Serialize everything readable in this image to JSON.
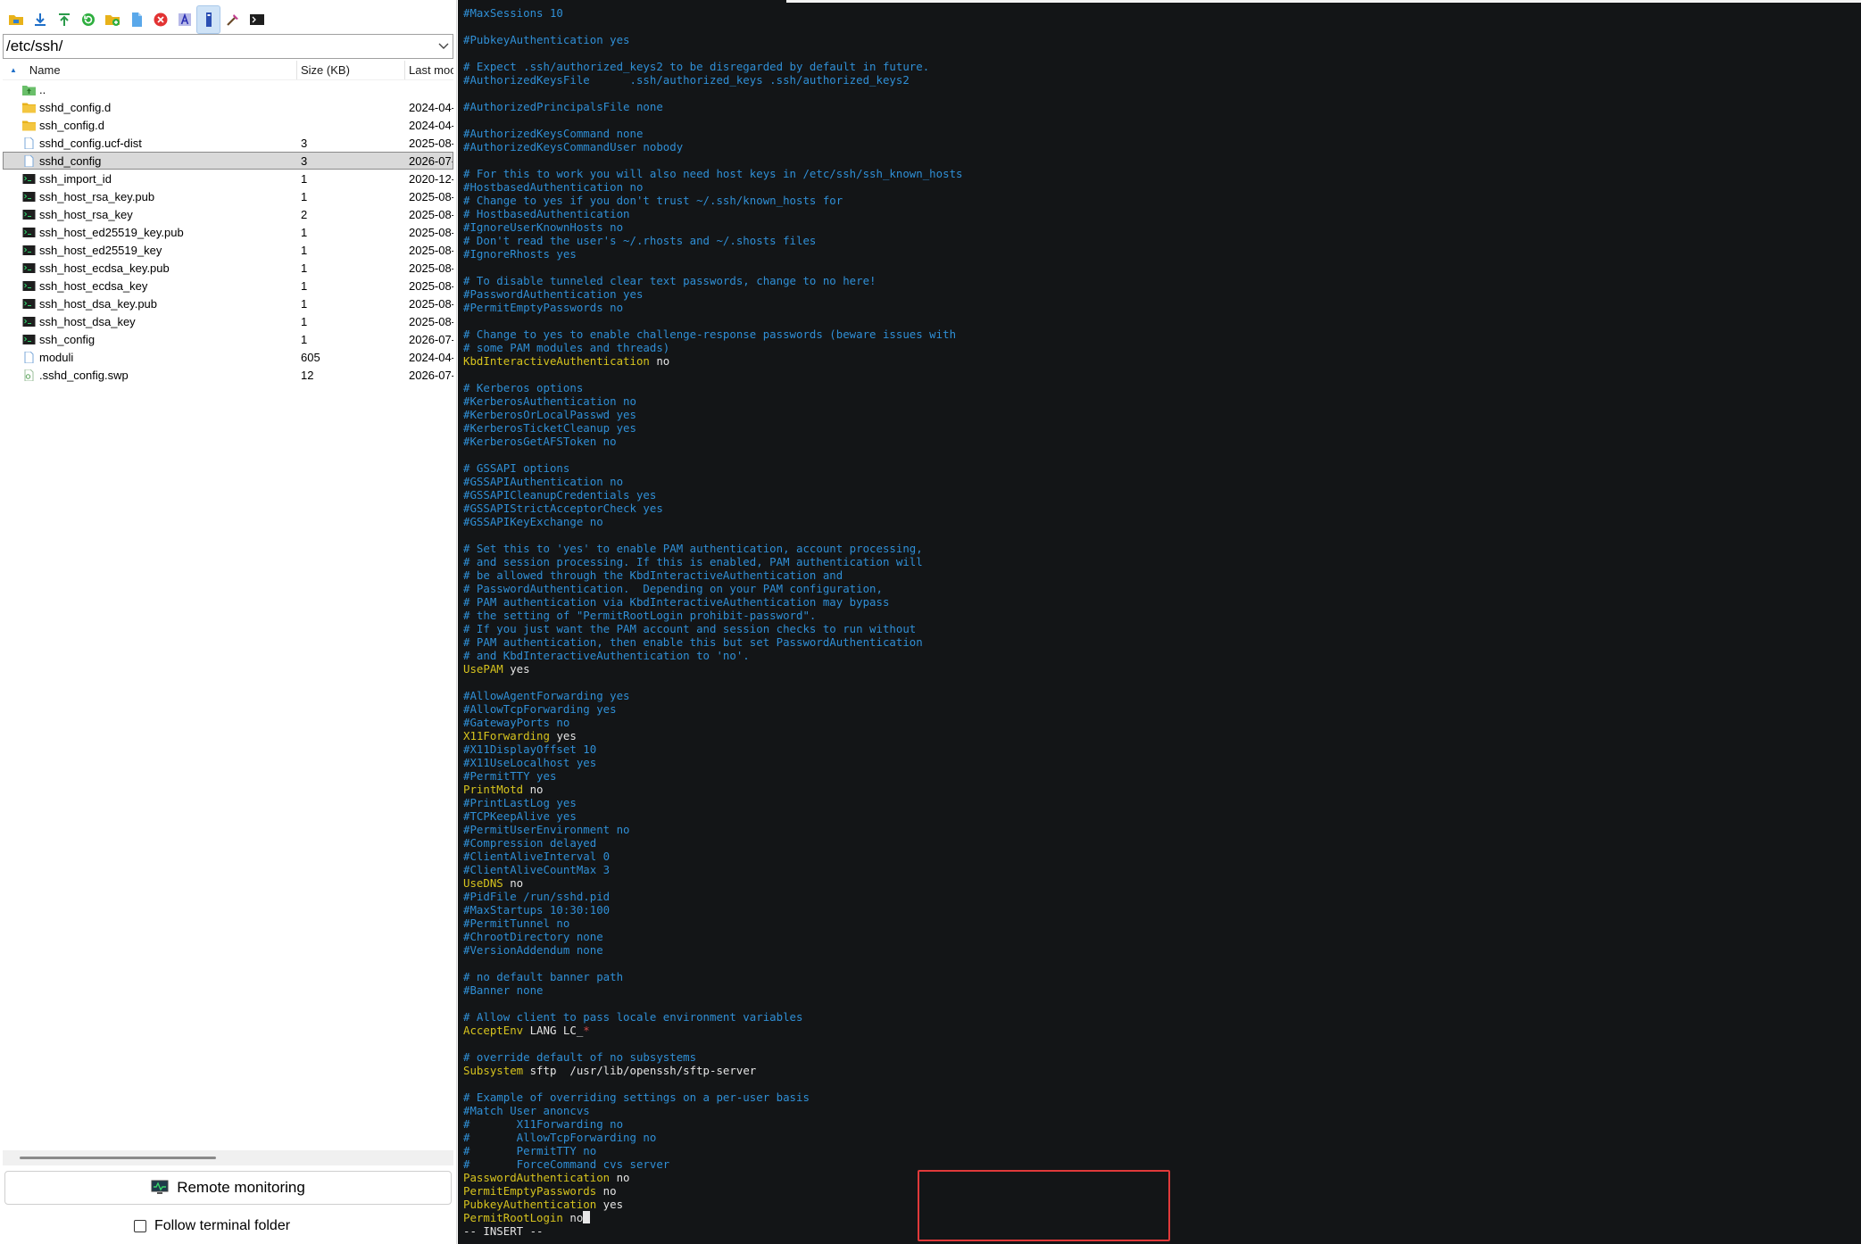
{
  "toolbar": {
    "icons": [
      "open-folder-icon",
      "download-icon",
      "upload-icon",
      "refresh-icon",
      "new-folder-icon",
      "new-file-icon",
      "delete-icon",
      "rename-icon",
      "show-hidden-icon",
      "tools-icon",
      "terminal-icon"
    ],
    "active_icon": "show-hidden-icon"
  },
  "path": {
    "value": "/etc/ssh/"
  },
  "columns": {
    "name": "Name",
    "size": "Size (KB)",
    "date": "Last moc"
  },
  "files": [
    {
      "name": "..",
      "size": "",
      "date": "",
      "icon": "up-folder-icon",
      "selected": false
    },
    {
      "name": "sshd_config.d",
      "size": "",
      "date": "2024-04-",
      "icon": "folder-icon",
      "selected": false
    },
    {
      "name": "ssh_config.d",
      "size": "",
      "date": "2024-04-",
      "icon": "folder-icon",
      "selected": false
    },
    {
      "name": "sshd_config.ucf-dist",
      "size": "3",
      "date": "2025-08-",
      "icon": "text-file-icon",
      "selected": false
    },
    {
      "name": "sshd_config",
      "size": "3",
      "date": "2026-07-",
      "icon": "text-file-icon",
      "selected": true
    },
    {
      "name": "ssh_import_id",
      "size": "1",
      "date": "2020-12-",
      "icon": "console-file-icon",
      "selected": false
    },
    {
      "name": "ssh_host_rsa_key.pub",
      "size": "1",
      "date": "2025-08-",
      "icon": "console-file-icon",
      "selected": false
    },
    {
      "name": "ssh_host_rsa_key",
      "size": "2",
      "date": "2025-08-",
      "icon": "console-file-icon",
      "selected": false
    },
    {
      "name": "ssh_host_ed25519_key.pub",
      "size": "1",
      "date": "2025-08-",
      "icon": "console-file-icon",
      "selected": false
    },
    {
      "name": "ssh_host_ed25519_key",
      "size": "1",
      "date": "2025-08-",
      "icon": "console-file-icon",
      "selected": false
    },
    {
      "name": "ssh_host_ecdsa_key.pub",
      "size": "1",
      "date": "2025-08-",
      "icon": "console-file-icon",
      "selected": false
    },
    {
      "name": "ssh_host_ecdsa_key",
      "size": "1",
      "date": "2025-08-",
      "icon": "console-file-icon",
      "selected": false
    },
    {
      "name": "ssh_host_dsa_key.pub",
      "size": "1",
      "date": "2025-08-",
      "icon": "console-file-icon",
      "selected": false
    },
    {
      "name": "ssh_host_dsa_key",
      "size": "1",
      "date": "2025-08-",
      "icon": "console-file-icon",
      "selected": false
    },
    {
      "name": "ssh_config",
      "size": "1",
      "date": "2026-07-",
      "icon": "console-file-icon",
      "selected": false
    },
    {
      "name": "moduli",
      "size": "605",
      "date": "2024-04-",
      "icon": "text-file-icon",
      "selected": false
    },
    {
      "name": ".sshd_config.swp",
      "size": "12",
      "date": "2026-07-",
      "icon": "swap-file-icon",
      "selected": false
    }
  ],
  "remote_monitoring": {
    "label": "Remote monitoring"
  },
  "follow_terminal": {
    "label": "Follow terminal folder",
    "checked": false
  },
  "colors": {
    "comment": "#2f8fd6",
    "keyword": "#d6c31e",
    "value": "#e4e4e4",
    "highlight_border": "#e0393a",
    "terminal_bg": "#131517"
  },
  "terminal": {
    "lines": [
      [
        {
          "t": "#MaxSessions 10",
          "s": "c"
        }
      ],
      [],
      [
        {
          "t": "#PubkeyAuthentication yes",
          "s": "c"
        }
      ],
      [],
      [
        {
          "t": "# Expect .ssh/authorized_keys2 to be disregarded by default in future.",
          "s": "c"
        }
      ],
      [
        {
          "t": "#AuthorizedKeysFile      .ssh/authorized_keys .ssh/authorized_keys2",
          "s": "c"
        }
      ],
      [],
      [
        {
          "t": "#AuthorizedPrincipalsFile none",
          "s": "c"
        }
      ],
      [],
      [
        {
          "t": "#AuthorizedKeysCommand none",
          "s": "c"
        }
      ],
      [
        {
          "t": "#AuthorizedKeysCommandUser nobody",
          "s": "c"
        }
      ],
      [],
      [
        {
          "t": "# For this to work you will also need host keys in /etc/ssh/ssh_known_hosts",
          "s": "c"
        }
      ],
      [
        {
          "t": "#HostbasedAuthentication no",
          "s": "c"
        }
      ],
      [
        {
          "t": "# Change to yes if you don't trust ~/.ssh/known_hosts for",
          "s": "c"
        }
      ],
      [
        {
          "t": "# HostbasedAuthentication",
          "s": "c"
        }
      ],
      [
        {
          "t": "#IgnoreUserKnownHosts no",
          "s": "c"
        }
      ],
      [
        {
          "t": "# Don't read the user's ~/.rhosts and ~/.shosts files",
          "s": "c"
        }
      ],
      [
        {
          "t": "#IgnoreRhosts yes",
          "s": "c"
        }
      ],
      [],
      [
        {
          "t": "# To disable tunneled clear text passwords, change to no here!",
          "s": "c"
        }
      ],
      [
        {
          "t": "#PasswordAuthentication yes",
          "s": "c"
        }
      ],
      [
        {
          "t": "#PermitEmptyPasswords no",
          "s": "c"
        }
      ],
      [],
      [
        {
          "t": "# Change to yes to enable challenge-response passwords (beware issues with",
          "s": "c"
        }
      ],
      [
        {
          "t": "# some PAM modules and threads)",
          "s": "c"
        }
      ],
      [
        {
          "t": "KbdInteractiveAuthentication",
          "s": "k"
        },
        {
          "t": " no",
          "s": "v"
        }
      ],
      [],
      [
        {
          "t": "# Kerberos options",
          "s": "c"
        }
      ],
      [
        {
          "t": "#KerberosAuthentication no",
          "s": "c"
        }
      ],
      [
        {
          "t": "#KerberosOrLocalPasswd yes",
          "s": "c"
        }
      ],
      [
        {
          "t": "#KerberosTicketCleanup yes",
          "s": "c"
        }
      ],
      [
        {
          "t": "#KerberosGetAFSToken no",
          "s": "c"
        }
      ],
      [],
      [
        {
          "t": "# GSSAPI options",
          "s": "c"
        }
      ],
      [
        {
          "t": "#GSSAPIAuthentication no",
          "s": "c"
        }
      ],
      [
        {
          "t": "#GSSAPICleanupCredentials yes",
          "s": "c"
        }
      ],
      [
        {
          "t": "#GSSAPIStrictAcceptorCheck yes",
          "s": "c"
        }
      ],
      [
        {
          "t": "#GSSAPIKeyExchange no",
          "s": "c"
        }
      ],
      [],
      [
        {
          "t": "# Set this to 'yes' to enable PAM authentication, account processing,",
          "s": "c"
        }
      ],
      [
        {
          "t": "# and session processing. If this is enabled, PAM authentication will",
          "s": "c"
        }
      ],
      [
        {
          "t": "# be allowed through the KbdInteractiveAuthentication and",
          "s": "c"
        }
      ],
      [
        {
          "t": "# PasswordAuthentication.  Depending on your PAM configuration,",
          "s": "c"
        }
      ],
      [
        {
          "t": "# PAM authentication via KbdInteractiveAuthentication may bypass",
          "s": "c"
        }
      ],
      [
        {
          "t": "# the setting of \"PermitRootLogin prohibit-password\".",
          "s": "c"
        }
      ],
      [
        {
          "t": "# If you just want the PAM account and session checks to run without",
          "s": "c"
        }
      ],
      [
        {
          "t": "# PAM authentication, then enable this but set PasswordAuthentication",
          "s": "c"
        }
      ],
      [
        {
          "t": "# and KbdInteractiveAuthentication to 'no'.",
          "s": "c"
        }
      ],
      [
        {
          "t": "UsePAM",
          "s": "k"
        },
        {
          "t": " yes",
          "s": "v"
        }
      ],
      [],
      [
        {
          "t": "#AllowAgentForwarding yes",
          "s": "c"
        }
      ],
      [
        {
          "t": "#AllowTcpForwarding yes",
          "s": "c"
        }
      ],
      [
        {
          "t": "#GatewayPorts no",
          "s": "c"
        }
      ],
      [
        {
          "t": "X11Forwarding",
          "s": "k"
        },
        {
          "t": " yes",
          "s": "v"
        }
      ],
      [
        {
          "t": "#X11DisplayOffset 10",
          "s": "c"
        }
      ],
      [
        {
          "t": "#X11UseLocalhost yes",
          "s": "c"
        }
      ],
      [
        {
          "t": "#PermitTTY yes",
          "s": "c"
        }
      ],
      [
        {
          "t": "PrintMotd",
          "s": "k"
        },
        {
          "t": " no",
          "s": "v"
        }
      ],
      [
        {
          "t": "#PrintLastLog yes",
          "s": "c"
        }
      ],
      [
        {
          "t": "#TCPKeepAlive yes",
          "s": "c"
        }
      ],
      [
        {
          "t": "#PermitUserEnvironment no",
          "s": "c"
        }
      ],
      [
        {
          "t": "#Compression delayed",
          "s": "c"
        }
      ],
      [
        {
          "t": "#ClientAliveInterval 0",
          "s": "c"
        }
      ],
      [
        {
          "t": "#ClientAliveCountMax 3",
          "s": "c"
        }
      ],
      [
        {
          "t": "UseDNS",
          "s": "k"
        },
        {
          "t": " no",
          "s": "v"
        }
      ],
      [
        {
          "t": "#PidFile /run/sshd.pid",
          "s": "c"
        }
      ],
      [
        {
          "t": "#MaxStartups 10:30:100",
          "s": "c"
        }
      ],
      [
        {
          "t": "#PermitTunnel no",
          "s": "c"
        }
      ],
      [
        {
          "t": "#ChrootDirectory none",
          "s": "c"
        }
      ],
      [
        {
          "t": "#VersionAddendum none",
          "s": "c"
        }
      ],
      [],
      [
        {
          "t": "# no default banner path",
          "s": "c"
        }
      ],
      [
        {
          "t": "#Banner none",
          "s": "c"
        }
      ],
      [],
      [
        {
          "t": "# Allow client to pass locale environment variables",
          "s": "c"
        }
      ],
      [
        {
          "t": "AcceptEnv",
          "s": "k"
        },
        {
          "t": " LANG LC_",
          "s": "v"
        },
        {
          "t": "*",
          "s": "r"
        }
      ],
      [],
      [
        {
          "t": "# override default of no subsystems",
          "s": "c"
        }
      ],
      [
        {
          "t": "Subsystem",
          "s": "k"
        },
        {
          "t": " sftp  /usr/lib/openssh/sftp-server",
          "s": "v"
        }
      ],
      [],
      [
        {
          "t": "# Example of overriding settings on a per-user basis",
          "s": "c"
        }
      ],
      [
        {
          "t": "#Match User anoncvs",
          "s": "c"
        }
      ],
      [
        {
          "t": "#       X11Forwarding no",
          "s": "c"
        }
      ],
      [
        {
          "t": "#       AllowTcpForwarding no",
          "s": "c"
        }
      ],
      [
        {
          "t": "#       PermitTTY no",
          "s": "c"
        }
      ],
      [
        {
          "t": "#       ForceCommand cvs server",
          "s": "c"
        }
      ],
      [
        {
          "t": "PasswordAuthentication",
          "s": "k"
        },
        {
          "t": " no",
          "s": "v"
        }
      ],
      [
        {
          "t": "PermitEmptyPasswords",
          "s": "k"
        },
        {
          "t": " no",
          "s": "v"
        }
      ],
      [
        {
          "t": "PubkeyAuthentication",
          "s": "k"
        },
        {
          "t": " yes",
          "s": "v"
        }
      ],
      [
        {
          "t": "PermitRootLogin",
          "s": "k"
        },
        {
          "t": " no",
          "s": "v"
        },
        {
          "cursor": true
        }
      ],
      [
        {
          "t": "-- INSERT --",
          "s": "v"
        }
      ]
    ]
  }
}
